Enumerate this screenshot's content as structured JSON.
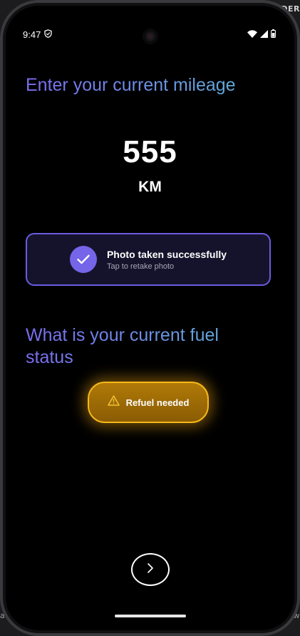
{
  "status_bar": {
    "time": "9:47",
    "icons": [
      "shield-icon",
      "wifi-icon",
      "cellular-icon",
      "battery-icon"
    ]
  },
  "background_text": {
    "top_right": "EDER",
    "bottom_left": "ar",
    "bottom_right": "ow"
  },
  "mileage": {
    "heading": "Enter your current mileage",
    "value": "555",
    "unit": "KM"
  },
  "photo_card": {
    "title": "Photo taken successfully",
    "subtitle": "Tap to retake photo",
    "icon": "check-icon"
  },
  "fuel": {
    "heading": "What is your current fuel status",
    "status_label": "Refuel needed",
    "status_icon": "warning-icon"
  },
  "navigation": {
    "next_icon": "chevron-right-icon"
  },
  "colors": {
    "accent_purple": "#7565e8",
    "heading_gradient_start": "#7b6cf0",
    "heading_gradient_end": "#5fb0d8",
    "warning_amber": "#f6b81a"
  }
}
